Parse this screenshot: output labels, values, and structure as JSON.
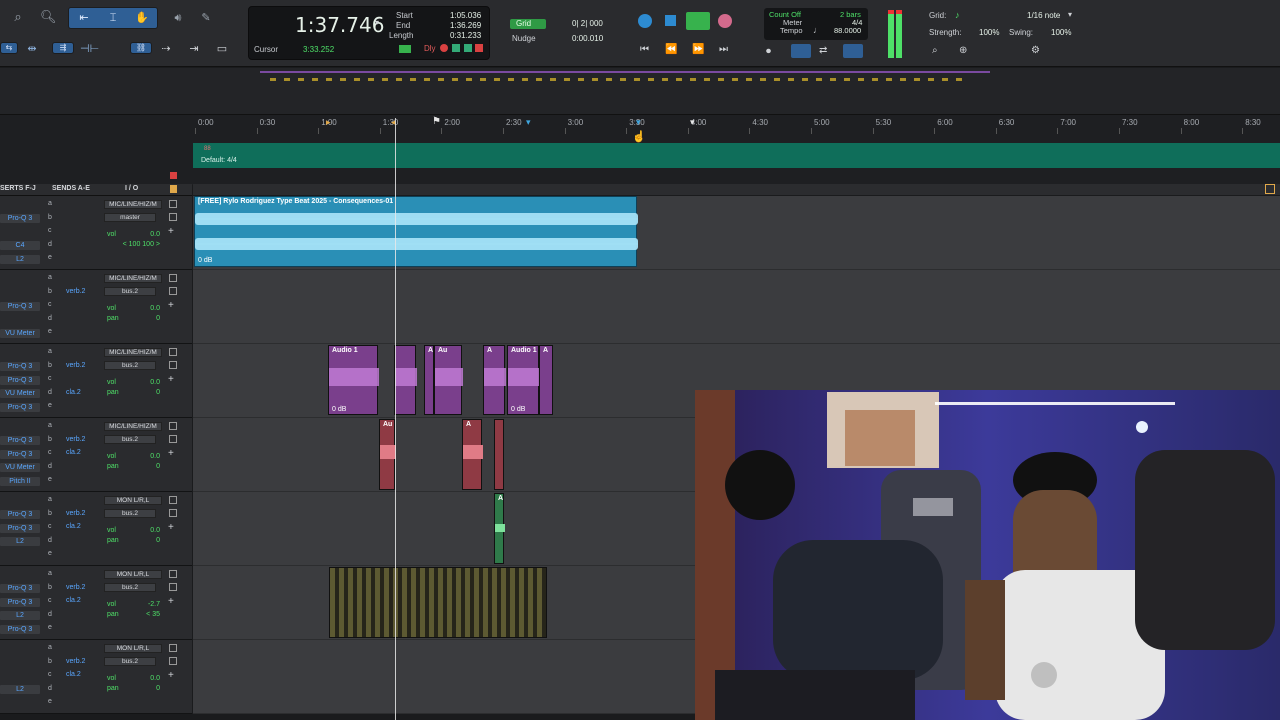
{
  "transport": {
    "main_counter": "1:37.746",
    "start_label": "Start",
    "start_value": "1:05.036",
    "end_label": "End",
    "end_value": "1:36.269",
    "length_label": "Length",
    "length_value": "0:31.233",
    "cursor_label": "Cursor",
    "cursor_value": "3:33.252",
    "dly_label": "Dly",
    "grid_label": "Grid",
    "grid_value": "0| 2| 000",
    "nudge_label": "Nudge",
    "nudge_value": "0:00.010",
    "count_off_label": "Count Off",
    "count_off_value": "2 bars",
    "meter_label": "Meter",
    "meter_value": "4/4",
    "tempo_label": "Tempo",
    "tempo_value": "88.0000",
    "grid2_label": "Grid:",
    "grid2_value": "1/16 note",
    "strength_label": "Strength:",
    "strength_value": "100%",
    "swing_label": "Swing:",
    "swing_value": "100%"
  },
  "ruler": {
    "ticks": [
      "0:00",
      "0:30",
      "1:00",
      "1:30",
      "2:00",
      "2:30",
      "3:00",
      "3:30",
      "4:00",
      "4:30",
      "5:00",
      "5:30",
      "6:00",
      "6:30",
      "7:00",
      "7:30",
      "8:00",
      "8:30"
    ],
    "tempo_marker": "88",
    "meter_marker": "Default: 4/4"
  },
  "track_headers": {
    "inserts": "SERTS F-J",
    "sends": "SENDS A-E",
    "io": "I / O"
  },
  "tracks": [
    {
      "inserts": [
        "Pro-Q 3",
        "",
        "C4",
        "L2"
      ],
      "letters": [
        "a",
        "b",
        "c",
        "d",
        "e"
      ],
      "sends": [
        "",
        "",
        "",
        "",
        ""
      ],
      "io_in": "MIC/LINE/HIZ/M",
      "io_out": "master",
      "vol": "0.0",
      "pan": "< 100  100 >",
      "pan_label": ""
    },
    {
      "inserts": [
        "",
        "Pro-Q 3",
        "",
        "VU Meter"
      ],
      "letters": [
        "a",
        "b",
        "c",
        "d",
        "e"
      ],
      "sends": [
        "",
        "verb.2",
        "",
        "",
        ""
      ],
      "io_in": "MIC/LINE/HIZ/M",
      "io_out": "bus.2",
      "vol": "0.0",
      "pan": "0",
      "pan_label": "pan"
    },
    {
      "inserts": [
        "Pro-Q 3",
        "Pro-Q 3",
        "VU Meter",
        "Pro-Q 3"
      ],
      "letters": [
        "a",
        "b",
        "c",
        "d",
        "e"
      ],
      "sends": [
        "",
        "verb.2",
        "",
        "cla.2",
        ""
      ],
      "io_in": "MIC/LINE/HIZ/M",
      "io_out": "bus.2",
      "vol": "0.0",
      "pan": "0",
      "pan_label": "pan"
    },
    {
      "inserts": [
        "Pro-Q 3",
        "Pro-Q 3",
        "VU Meter",
        "Pitch II"
      ],
      "letters": [
        "a",
        "b",
        "c",
        "d",
        "e"
      ],
      "sends": [
        "",
        "verb.2",
        "cla.2",
        "",
        ""
      ],
      "io_in": "MIC/LINE/HIZ/M",
      "io_out": "bus.2",
      "vol": "0.0",
      "pan": "0",
      "pan_label": "pan"
    },
    {
      "inserts": [
        "Pro-Q 3",
        "Pro-Q 3",
        "L2",
        ""
      ],
      "letters": [
        "a",
        "b",
        "c",
        "d",
        "e"
      ],
      "sends": [
        "",
        "verb.2",
        "cla.2",
        "",
        ""
      ],
      "io_in": "MON L/R,L",
      "io_out": "bus.2",
      "vol": "0.0",
      "pan": "0",
      "pan_label": "pan"
    },
    {
      "inserts": [
        "Pro-Q 3",
        "Pro-Q 3",
        "L2",
        "Pro-Q 3"
      ],
      "letters": [
        "a",
        "b",
        "c",
        "d",
        "e"
      ],
      "sends": [
        "",
        "verb.2",
        "cla.2",
        "",
        ""
      ],
      "io_in": "MON L/R,L",
      "io_out": "bus.2",
      "vol": "-2.7",
      "pan": "< 35",
      "pan_label": "pan"
    },
    {
      "inserts": [
        "",
        "",
        "L2",
        ""
      ],
      "letters": [
        "a",
        "b",
        "c",
        "d",
        "e"
      ],
      "sends": [
        "",
        "verb.2",
        "cla.2",
        "",
        ""
      ],
      "io_in": "MON L/R,L",
      "io_out": "bus.2",
      "vol": "0.0",
      "pan": "0",
      "pan_label": "pan"
    }
  ],
  "clips": {
    "beat_name": "[FREE] Rylo Rodriguez Type Beat 2025 - Consequences-01",
    "beat_gain": "0 dB",
    "audio1": "Audio 1",
    "au_short": "Au",
    "a_short": "A",
    "gain": "0 dB"
  },
  "vol_label": "vol",
  "colors": {
    "accent_blue": "#2f5f95",
    "clip_blue": "#2a8fb6",
    "clip_purple": "#7a3f8c",
    "clip_red": "#8f3a44",
    "clip_green": "#2f7a4a",
    "clip_olive": "#5d5a32",
    "timeline_green": "#0f6e5a"
  }
}
